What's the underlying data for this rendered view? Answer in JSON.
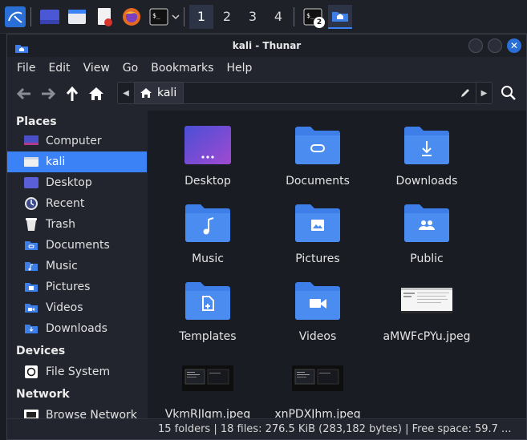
{
  "panel": {
    "workspaces": [
      "1",
      "2",
      "3",
      "4"
    ],
    "terminal_badge": "2",
    "terminal_prompt": "$_"
  },
  "window": {
    "title": "kali - Thunar"
  },
  "menu": {
    "items": [
      "File",
      "Edit",
      "View",
      "Go",
      "Bookmarks",
      "Help"
    ]
  },
  "pathbar": {
    "current": "kali"
  },
  "sidebar": {
    "places_header": "Places",
    "places": [
      {
        "label": "Computer",
        "icon": "computer-icon"
      },
      {
        "label": "kali",
        "icon": "home-folder-icon",
        "selected": true
      },
      {
        "label": "Desktop",
        "icon": "desktop-icon"
      },
      {
        "label": "Recent",
        "icon": "recent-icon"
      },
      {
        "label": "Trash",
        "icon": "trash-icon"
      },
      {
        "label": "Documents",
        "icon": "documents-folder-icon"
      },
      {
        "label": "Music",
        "icon": "music-folder-icon"
      },
      {
        "label": "Pictures",
        "icon": "pictures-folder-icon"
      },
      {
        "label": "Videos",
        "icon": "videos-folder-icon"
      },
      {
        "label": "Downloads",
        "icon": "downloads-folder-icon"
      }
    ],
    "devices_header": "Devices",
    "devices": [
      {
        "label": "File System",
        "icon": "drive-icon"
      }
    ],
    "network_header": "Network",
    "network": [
      {
        "label": "Browse Network",
        "icon": "network-icon"
      }
    ]
  },
  "files": [
    {
      "label": "Desktop",
      "icon": "desktop-icon"
    },
    {
      "label": "Documents",
      "icon": "documents-folder-icon"
    },
    {
      "label": "Downloads",
      "icon": "downloads-folder-icon"
    },
    {
      "label": "Music",
      "icon": "music-folder-icon"
    },
    {
      "label": "Pictures",
      "icon": "pictures-folder-icon"
    },
    {
      "label": "Public",
      "icon": "public-folder-icon"
    },
    {
      "label": "Templates",
      "icon": "templates-folder-icon"
    },
    {
      "label": "Videos",
      "icon": "videos-folder-icon"
    },
    {
      "label": "aMWFcPYu.jpeg",
      "icon": "image-thumbnail-icon"
    },
    {
      "label": "VkmRJIgm.jpeg",
      "icon": "image-thumbnail-icon"
    },
    {
      "label": "xnPDXJhm.jpeg",
      "icon": "image-thumbnail-icon"
    }
  ],
  "status": {
    "text": "15 folders | 18 files: 276.5 KiB (283,182 bytes) | Free space: 59.7 ..."
  },
  "colors": {
    "accent": "#3b82f6",
    "folder": "#3d7ee8",
    "window_bg": "#23252e",
    "view_bg": "#1a1c24"
  }
}
